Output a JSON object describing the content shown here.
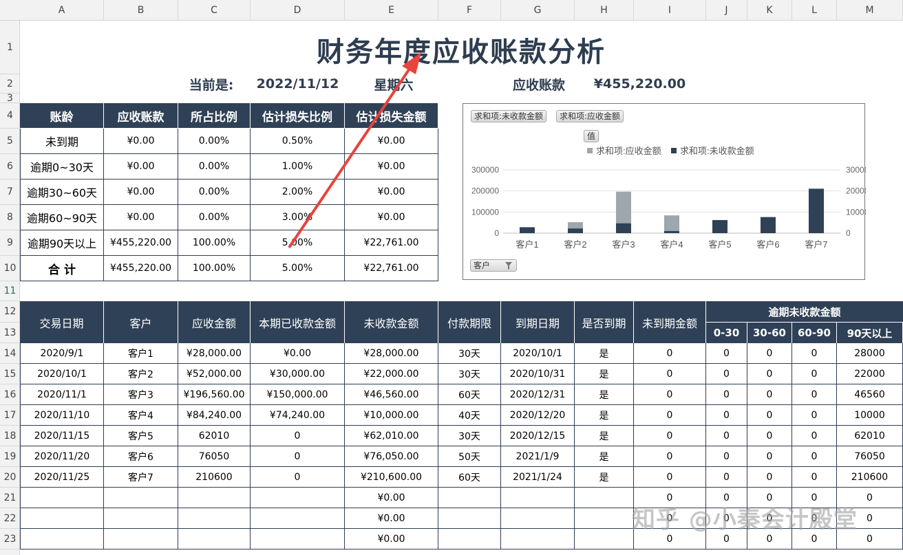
{
  "columns": [
    "A",
    "B",
    "C",
    "D",
    "E",
    "F",
    "G",
    "H",
    "I",
    "J",
    "K",
    "L",
    "M"
  ],
  "rows": [
    "1",
    "2",
    "3",
    "4",
    "5",
    "6",
    "7",
    "8",
    "9",
    "10",
    "11",
    "12",
    "13",
    "14",
    "15",
    "16",
    "17",
    "18",
    "19",
    "20",
    "21",
    "22",
    "23"
  ],
  "title": "财务年度应收账款分析",
  "current_label": "当前是:",
  "current_date": "2022/11/12",
  "weekday": "星期六",
  "receivable_label": "应收账款",
  "receivable_total": "¥455,220.00",
  "aging": {
    "headers": [
      "账龄",
      "应收账款",
      "所占比例",
      "估计损失比例",
      "估计损失金额"
    ],
    "rows": [
      [
        "未到期",
        "¥0.00",
        "0.00%",
        "0.50%",
        "¥0.00"
      ],
      [
        "逾期0~30天",
        "¥0.00",
        "0.00%",
        "1.00%",
        "¥0.00"
      ],
      [
        "逾期30~60天",
        "¥0.00",
        "0.00%",
        "2.00%",
        "¥0.00"
      ],
      [
        "逾期60~90天",
        "¥0.00",
        "0.00%",
        "3.00%",
        "¥0.00"
      ],
      [
        "逾期90天以上",
        "¥455,220.00",
        "100.00%",
        "5.00%",
        "¥22,761.00"
      ],
      [
        "合  计",
        "¥455,220.00",
        "100.00%",
        "5.00%",
        "¥22,761.00"
      ]
    ]
  },
  "detail": {
    "headers": [
      "交易日期",
      "客户",
      "应收金额",
      "本期已收款金额",
      "未收款金额",
      "付款期限",
      "到期日期",
      "是否到期",
      "未到期金额"
    ],
    "overdue_group": "逾期未收款金额",
    "overdue_cols": [
      "0-30",
      "30-60",
      "60-90",
      "90天以上"
    ],
    "rows": [
      [
        "2020/9/1",
        "客户1",
        "¥28,000.00",
        "¥0.00",
        "¥28,000.00",
        "30天",
        "2020/10/1",
        "是",
        "0",
        "0",
        "0",
        "0",
        "28000"
      ],
      [
        "2020/10/1",
        "客户2",
        "¥52,000.00",
        "¥30,000.00",
        "¥22,000.00",
        "30天",
        "2020/10/31",
        "是",
        "0",
        "0",
        "0",
        "0",
        "22000"
      ],
      [
        "2020/11/1",
        "客户3",
        "¥196,560.00",
        "¥150,000.00",
        "¥46,560.00",
        "60天",
        "2020/12/31",
        "是",
        "0",
        "0",
        "0",
        "0",
        "46560"
      ],
      [
        "2020/11/10",
        "客户4",
        "¥84,240.00",
        "¥74,240.00",
        "¥10,000.00",
        "40天",
        "2020/12/20",
        "是",
        "0",
        "0",
        "0",
        "0",
        "10000"
      ],
      [
        "2020/11/15",
        "客户5",
        "62010",
        "0",
        "¥62,010.00",
        "30天",
        "2020/12/15",
        "是",
        "0",
        "0",
        "0",
        "0",
        "62010"
      ],
      [
        "2020/11/20",
        "客户6",
        "76050",
        "0",
        "¥76,050.00",
        "50天",
        "2021/1/9",
        "是",
        "0",
        "0",
        "0",
        "0",
        "76050"
      ],
      [
        "2020/11/25",
        "客户7",
        "210600",
        "0",
        "¥210,600.00",
        "60天",
        "2021/1/24",
        "是",
        "0",
        "0",
        "0",
        "0",
        "210600"
      ],
      [
        "",
        "",
        "",
        "",
        "¥0.00",
        "",
        "",
        "",
        "0",
        "0",
        "0",
        "0",
        "0"
      ],
      [
        "",
        "",
        "",
        "",
        "¥0.00",
        "",
        "",
        "",
        "0",
        "0",
        "0",
        "0",
        "0"
      ],
      [
        "",
        "",
        "",
        "",
        "¥0.00",
        "",
        "",
        "",
        "0",
        "0",
        "0",
        "0",
        "0"
      ]
    ]
  },
  "chart_data": {
    "type": "bar",
    "pivot_fields": [
      "求和项:未收款金额",
      "求和项:应收金额"
    ],
    "values_button": "值",
    "axis_button": "客户",
    "categories": [
      "客户1",
      "客户2",
      "客户3",
      "客户4",
      "客户5",
      "客户6",
      "客户7"
    ],
    "series": [
      {
        "name": "求和项:应收金额",
        "values": [
          28000,
          52000,
          196560,
          84240,
          62010,
          76050,
          210600
        ],
        "color": "#9ea7ad"
      },
      {
        "name": "求和项:未收款金额",
        "values": [
          28000,
          22000,
          46560,
          10000,
          62010,
          76050,
          210600
        ],
        "color": "#2f4156"
      }
    ],
    "y_ticks": [
      "300000",
      "200000",
      "100000",
      "0"
    ],
    "ylim": [
      0,
      300000
    ],
    "legend": "top"
  },
  "watermark": "知乎 @小秦会计殿堂",
  "colors": {
    "header": "#2f4156",
    "arrow": "#e8433d"
  }
}
